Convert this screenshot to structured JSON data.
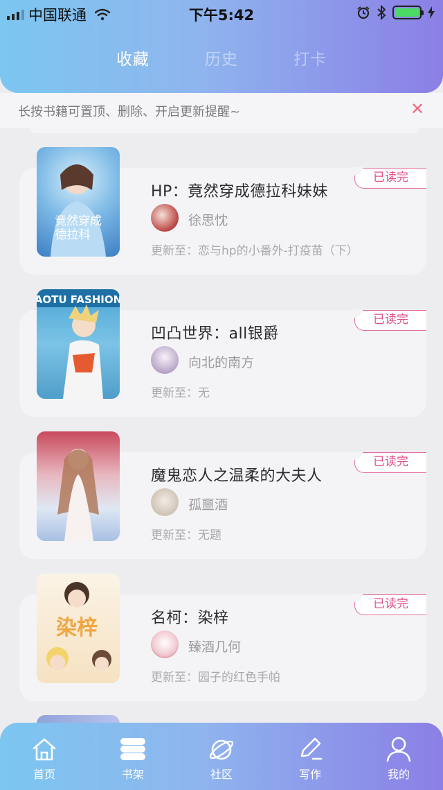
{
  "status_bar": {
    "carrier": "中国联通",
    "time": "下午5:42"
  },
  "tabs": [
    {
      "label": "收藏",
      "active": true
    },
    {
      "label": "历史",
      "active": false
    },
    {
      "label": "打卡",
      "active": false
    }
  ],
  "hint": {
    "text": "长按书籍可置顶、删除、开启更新提醒~",
    "close_icon": "close-icon"
  },
  "books": [
    {
      "title": "HP：竟然穿成德拉科妹妹",
      "author": "徐思忱",
      "update_label": "更新至：",
      "update_value": "恋与hp的小番外-打疫苗（下）",
      "badge": "已读完"
    },
    {
      "title": "凹凸世界：all银爵",
      "author": "向北的南方",
      "update_label": "更新至：",
      "update_value": "无",
      "badge": "已读完",
      "cover_text": "AOTU FASHION"
    },
    {
      "title": "魔鬼恋人之温柔的大夫人",
      "author": "孤噩酒",
      "update_label": "更新至：",
      "update_value": "无题",
      "badge": "已读完"
    },
    {
      "title": "名柯：染梓",
      "author": "臻酒几何",
      "update_label": "更新至：",
      "update_value": "园子的红色手帕",
      "badge": "已读完",
      "cover_text": "染梓"
    }
  ],
  "tabbar": [
    {
      "label": "首页",
      "icon": "home-icon"
    },
    {
      "label": "书架",
      "icon": "bookshelf-icon",
      "active": true
    },
    {
      "label": "社区",
      "icon": "planet-icon"
    },
    {
      "label": "写作",
      "icon": "pen-icon"
    },
    {
      "label": "我的",
      "icon": "user-icon"
    }
  ],
  "colors": {
    "header_gradient_start": "#7cc6f0",
    "header_gradient_end": "#8b7fe6",
    "badge": "#e2508d",
    "close": "#f06a7e"
  }
}
